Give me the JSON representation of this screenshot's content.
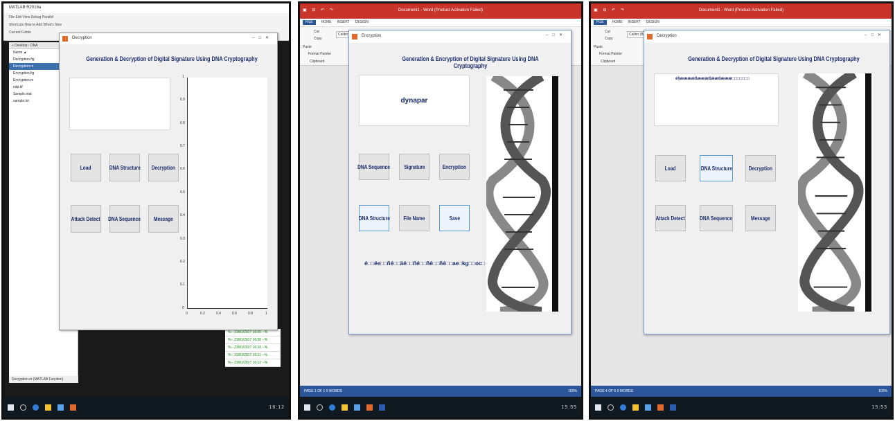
{
  "shot1": {
    "window_title": "MATLAB R2016a",
    "toolbar_row1": "File  Edit  View  Debug  Parallel",
    "toolbar_row2": "Shortcuts  How to Add  What's New",
    "current_folder_label": "Current Folder",
    "path_label": "« Desktop › DNA",
    "files_header": "Name ▲",
    "files": [
      "Decryption.fig",
      "Decryption.m",
      "Encryption.fig",
      "Encryption.m",
      "ndp.tif",
      "Sample.mat",
      "sample.txt"
    ],
    "selected_file_index": 1,
    "status_text": "Decryption.m (MATLAB Function)",
    "cmd_lines": [
      "%-- 23/01/2017 16:05 --%",
      "%-- 23/01/2017 16:06 --%",
      "%-- 23/01/2017 16:10 --%",
      "%-- 23/01/2017 16:11 --%",
      "%-- 23/01/2017 16:12 --%"
    ],
    "figure_title": "Decryption",
    "heading": "Generation & Decryption of Digital Signature Using DNA Cryptography",
    "buttons": [
      "Load",
      "DNA Structure",
      "Decryption",
      "Attack Detect",
      "DNA Sequence",
      "Message"
    ],
    "axes_yticks": [
      "1",
      "0.9",
      "0.8",
      "0.7",
      "0.6",
      "0.5",
      "0.4",
      "0.3",
      "0.2",
      "0.1",
      "0"
    ],
    "axes_xticks": [
      "0",
      "0.2",
      "0.4",
      "0.6",
      "0.8",
      "1"
    ],
    "clock": "16:12"
  },
  "shot2": {
    "word_title": "Document1 - Word (Product Activation Failed)",
    "tabs": [
      "FILE",
      "HOME",
      "INSERT",
      "DESIGN"
    ],
    "ribbon": {
      "cut": "Cut",
      "copy": "Copy",
      "paste": "Paste",
      "format_painter": "Format Painter",
      "font": "Calibri (Body)",
      "clipboard": "Clipboard"
    },
    "dialog_title": "Encryption",
    "heading": "Generation & Encryption of Digital Signature Using DNA Cryptography",
    "input_text": "dynapar",
    "buttons": [
      "DNA Sequence",
      "Signature",
      "Encryption",
      "DNA Structure",
      "File Name",
      "Save"
    ],
    "cipher_text": "é□□ée□□ñé□□äé□□ñé□□ñé□□ñé□□ae□kg□□oc□",
    "status_left": "PAGE 1 OF 1   0 WORDS",
    "status_right": "100%",
    "clock": "15:55"
  },
  "shot3": {
    "word_title": "Document1 - Word (Product Activation Failed)",
    "tabs": [
      "FILE",
      "HOME",
      "INSERT",
      "DESIGN"
    ],
    "ribbon": {
      "cut": "Cut",
      "copy": "Copy",
      "paste": "Paste",
      "format_painter": "Format Painter",
      "font": "Calibri (Body)",
      "clipboard": "Clipboard"
    },
    "dialog_title": "Decryption",
    "heading": "Generation & Decryption of Digital Signature Using DNA Cryptography",
    "panel_text": "é§ææææßæææßææßæææ□□□□□□□",
    "buttons": [
      "Load",
      "DNA Structure",
      "Decryption",
      "Attack Detect",
      "DNA Sequence",
      "Message"
    ],
    "status_left": "PAGE 4 OF 6   0 WORDS",
    "status_right": "100%",
    "clock": "15:53"
  },
  "colors": {
    "heading": "#1c2e6e",
    "word_red": "#c8332a",
    "word_blue": "#2b579a"
  }
}
